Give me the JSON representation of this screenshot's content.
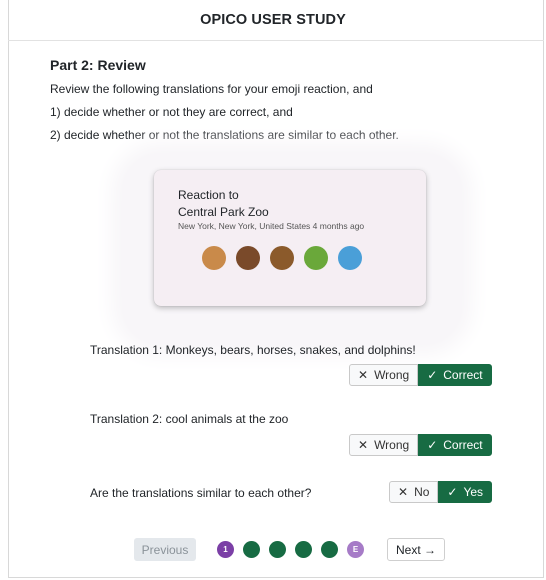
{
  "header": {
    "title": "OPICO USER STUDY"
  },
  "part": {
    "heading": "Part 2: Review",
    "instructions": [
      "Review the following translations for your emoji reaction, and",
      "1) decide whether or not they are correct, and",
      "2) decide whether or not the translations are similar to each other."
    ]
  },
  "card": {
    "reaction_label": "Reaction to",
    "place": "Central Park Zoo",
    "meta": "New York, New York, United States  4 months ago",
    "emojis": [
      {
        "name": "monkey-face",
        "color": "#c98a4a"
      },
      {
        "name": "bear-face",
        "color": "#7a4a2a"
      },
      {
        "name": "horse",
        "color": "#8b5a2b"
      },
      {
        "name": "snake",
        "color": "#6aa83a"
      },
      {
        "name": "dolphin",
        "color": "#4a9fd8"
      }
    ]
  },
  "translation1": {
    "text": "Translation 1: Monkeys, bears, horses, snakes, and dolphins!",
    "wrong": "Wrong",
    "correct": "Correct"
  },
  "translation2": {
    "text": "Translation 2: cool animals at the zoo",
    "wrong": "Wrong",
    "correct": "Correct"
  },
  "similar": {
    "text": "Are the translations similar to each other?",
    "no": "No",
    "yes": "Yes"
  },
  "nav": {
    "previous": "Previous",
    "next": "Next →",
    "steps": [
      "1",
      "",
      "",
      "",
      "",
      "E"
    ]
  },
  "colors": {
    "accent": "#176b43",
    "purple": "#7b3fa6"
  }
}
